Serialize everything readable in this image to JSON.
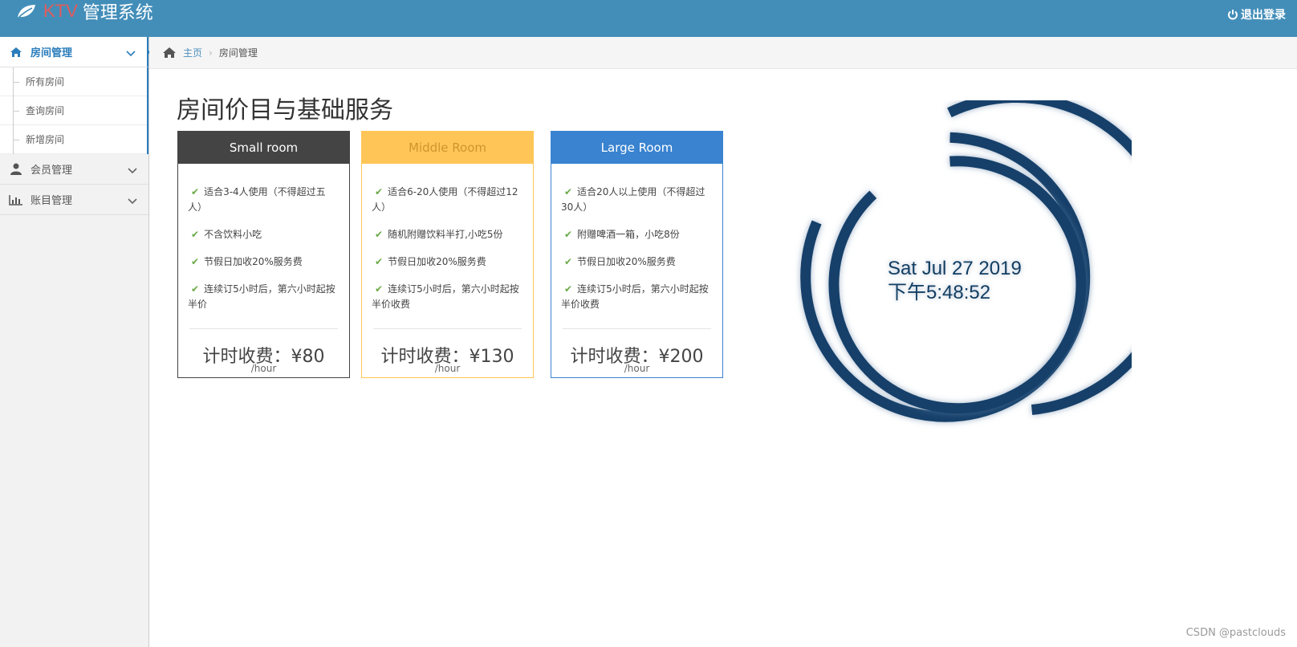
{
  "header": {
    "brand_ktv": "KTV",
    "brand_title": "管理系统",
    "logout_label": "退出登录",
    "bg_color": "#438eb9"
  },
  "sidebar": {
    "items": [
      {
        "label": "房间管理",
        "icon": "home-icon",
        "active": true,
        "children": [
          {
            "label": "所有房间"
          },
          {
            "label": "查询房间"
          },
          {
            "label": "新增房间"
          }
        ]
      },
      {
        "label": "会员管理",
        "icon": "user-icon"
      },
      {
        "label": "账目管理",
        "icon": "bar-chart-icon"
      }
    ]
  },
  "breadcrumb": {
    "home": "主页",
    "current": "房间管理"
  },
  "main": {
    "title": "房间价目与基础服务"
  },
  "plans": [
    {
      "name": "Small room",
      "header_color": "#444444",
      "features": [
        "适合3-4人使用（不得超过五人）",
        "不含饮料小吃",
        "节假日加收20%服务费",
        "连续订5小时后，第六小时起按半价"
      ],
      "price": "计时收费：¥80",
      "per": "/hour"
    },
    {
      "name": "Middle Room",
      "header_color": "#ffc657",
      "features": [
        "适合6-20人使用（不得超过12人）",
        "随机附赠饮料半打,小吃5份",
        "节假日加收20%服务费",
        "连续订5小时后，第六小时起按半价收费"
      ],
      "price": "计时收费：¥130",
      "per": "/hour"
    },
    {
      "name": "Large Room",
      "header_color": "#3983d0",
      "features": [
        "适合20人以上使用（不得超过30人）",
        "附赠啤酒一箱，小吃8份",
        "节假日加收20%服务费",
        "连续订5小时后，第六小时起按半价收费"
      ],
      "price": "计时收费：¥200",
      "per": "/hour"
    }
  ],
  "clock": {
    "date": "Sat Jul 27 2019",
    "time": "下午5:48:52",
    "ring_color": "#12406a"
  },
  "watermark": "CSDN @pastclouds"
}
